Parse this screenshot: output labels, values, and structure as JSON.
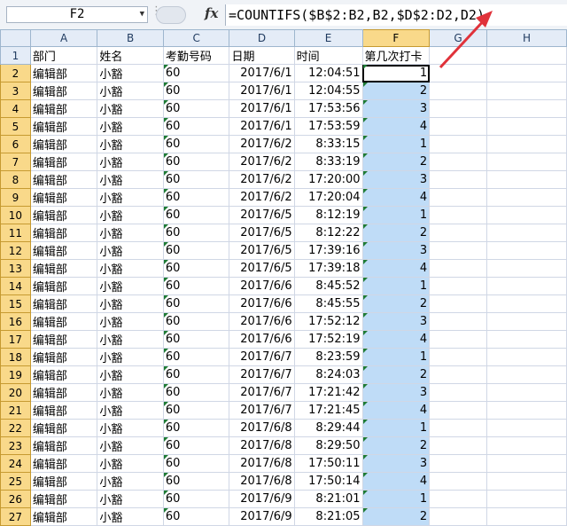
{
  "formula_bar": {
    "name_box": "F2",
    "fx_label": "fx",
    "formula": "=COUNTIFS($B$2:B2,B2,$D$2:D2,D2)"
  },
  "columns": [
    "A",
    "B",
    "C",
    "D",
    "E",
    "F",
    "G",
    "H"
  ],
  "selected_column": "F",
  "header_row": {
    "row": "1",
    "cells": [
      "部门",
      "姓名",
      "考勤号码",
      "日期",
      "时间",
      "第几次打卡",
      "",
      ""
    ]
  },
  "rows": [
    {
      "row": "2",
      "dept": "编辑部",
      "name": "小豁",
      "code": "60",
      "date": "2017/6/1",
      "time": "12:04:51",
      "count": "1"
    },
    {
      "row": "3",
      "dept": "编辑部",
      "name": "小豁",
      "code": "60",
      "date": "2017/6/1",
      "time": "12:04:55",
      "count": "2"
    },
    {
      "row": "4",
      "dept": "编辑部",
      "name": "小豁",
      "code": "60",
      "date": "2017/6/1",
      "time": "17:53:56",
      "count": "3"
    },
    {
      "row": "5",
      "dept": "编辑部",
      "name": "小豁",
      "code": "60",
      "date": "2017/6/1",
      "time": "17:53:59",
      "count": "4"
    },
    {
      "row": "6",
      "dept": "编辑部",
      "name": "小豁",
      "code": "60",
      "date": "2017/6/2",
      "time": "8:33:15",
      "count": "1"
    },
    {
      "row": "7",
      "dept": "编辑部",
      "name": "小豁",
      "code": "60",
      "date": "2017/6/2",
      "time": "8:33:19",
      "count": "2"
    },
    {
      "row": "8",
      "dept": "编辑部",
      "name": "小豁",
      "code": "60",
      "date": "2017/6/2",
      "time": "17:20:00",
      "count": "3"
    },
    {
      "row": "9",
      "dept": "编辑部",
      "name": "小豁",
      "code": "60",
      "date": "2017/6/2",
      "time": "17:20:04",
      "count": "4"
    },
    {
      "row": "10",
      "dept": "编辑部",
      "name": "小豁",
      "code": "60",
      "date": "2017/6/5",
      "time": "8:12:19",
      "count": "1"
    },
    {
      "row": "11",
      "dept": "编辑部",
      "name": "小豁",
      "code": "60",
      "date": "2017/6/5",
      "time": "8:12:22",
      "count": "2"
    },
    {
      "row": "12",
      "dept": "编辑部",
      "name": "小豁",
      "code": "60",
      "date": "2017/6/5",
      "time": "17:39:16",
      "count": "3"
    },
    {
      "row": "13",
      "dept": "编辑部",
      "name": "小豁",
      "code": "60",
      "date": "2017/6/5",
      "time": "17:39:18",
      "count": "4"
    },
    {
      "row": "14",
      "dept": "编辑部",
      "name": "小豁",
      "code": "60",
      "date": "2017/6/6",
      "time": "8:45:52",
      "count": "1"
    },
    {
      "row": "15",
      "dept": "编辑部",
      "name": "小豁",
      "code": "60",
      "date": "2017/6/6",
      "time": "8:45:55",
      "count": "2"
    },
    {
      "row": "16",
      "dept": "编辑部",
      "name": "小豁",
      "code": "60",
      "date": "2017/6/6",
      "time": "17:52:12",
      "count": "3"
    },
    {
      "row": "17",
      "dept": "编辑部",
      "name": "小豁",
      "code": "60",
      "date": "2017/6/6",
      "time": "17:52:19",
      "count": "4"
    },
    {
      "row": "18",
      "dept": "编辑部",
      "name": "小豁",
      "code": "60",
      "date": "2017/6/7",
      "time": "8:23:59",
      "count": "1"
    },
    {
      "row": "19",
      "dept": "编辑部",
      "name": "小豁",
      "code": "60",
      "date": "2017/6/7",
      "time": "8:24:03",
      "count": "2"
    },
    {
      "row": "20",
      "dept": "编辑部",
      "name": "小豁",
      "code": "60",
      "date": "2017/6/7",
      "time": "17:21:42",
      "count": "3"
    },
    {
      "row": "21",
      "dept": "编辑部",
      "name": "小豁",
      "code": "60",
      "date": "2017/6/7",
      "time": "17:21:45",
      "count": "4"
    },
    {
      "row": "22",
      "dept": "编辑部",
      "name": "小豁",
      "code": "60",
      "date": "2017/6/8",
      "time": "8:29:44",
      "count": "1"
    },
    {
      "row": "23",
      "dept": "编辑部",
      "name": "小豁",
      "code": "60",
      "date": "2017/6/8",
      "time": "8:29:50",
      "count": "2"
    },
    {
      "row": "24",
      "dept": "编辑部",
      "name": "小豁",
      "code": "60",
      "date": "2017/6/8",
      "time": "17:50:11",
      "count": "3"
    },
    {
      "row": "25",
      "dept": "编辑部",
      "name": "小豁",
      "code": "60",
      "date": "2017/6/8",
      "time": "17:50:14",
      "count": "4"
    },
    {
      "row": "26",
      "dept": "编辑部",
      "name": "小豁",
      "code": "60",
      "date": "2017/6/9",
      "time": "8:21:01",
      "count": "1"
    },
    {
      "row": "27",
      "dept": "编辑部",
      "name": "小豁",
      "code": "60",
      "date": "2017/6/9",
      "time": "8:21:05",
      "count": "2"
    }
  ],
  "colors": {
    "selection_fill": "#bfdcf7",
    "header_fill": "#e4ecf7",
    "selected_header": "#f9d98a",
    "arrow": "#e0323a"
  }
}
